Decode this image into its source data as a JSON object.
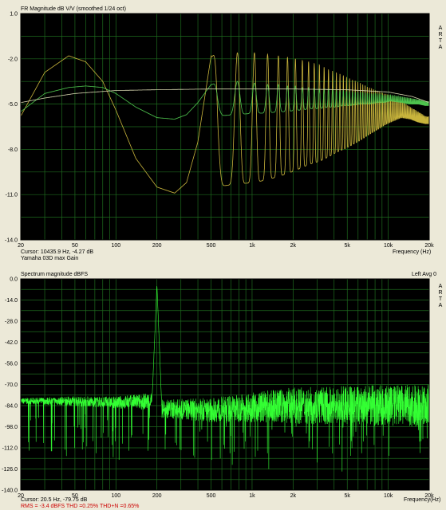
{
  "top": {
    "title": "FR Magnitude dB V/V (smoothed 1/24 oct)",
    "arta": [
      "A",
      "R",
      "T",
      "A"
    ],
    "cursor": "Cursor: 10435.9 Hz, -4.27 dB",
    "device": "Yamaha 03D max Gain",
    "xunit": "Frequency (Hz)"
  },
  "bottom": {
    "title": "Spectrum magnitude dBFS",
    "right": "Left  Avg 0",
    "arta": [
      "A",
      "R",
      "T",
      "A"
    ],
    "cursor": "Cursor:  20.5 Hz, -79.75 dB",
    "stats": "RMS =  -3.4 dBFS   THD =0.25%   THD+N =0.65%",
    "xunit": "Frequency(Hz)"
  },
  "chart_data": [
    {
      "type": "line",
      "title": "FR Magnitude dB V/V (smoothed 1/24 oct)",
      "xlabel": "Frequency (Hz)",
      "ylabel": "",
      "x_scale": "log",
      "xlim": [
        20,
        20000
      ],
      "ylim": [
        -14.0,
        1.0
      ],
      "yticks": [
        "1.0",
        "-2.0",
        "-5.0",
        "-8.0",
        "-11.0",
        "-14.0"
      ],
      "xticks": [
        "20",
        "50",
        "100",
        "200",
        "500",
        "1k",
        "2k",
        "5k",
        "10k",
        "20k"
      ],
      "grid": true,
      "background": "#000000",
      "grid_color": "#1e6a1e",
      "series": [
        {
          "color": "#c8b43c",
          "model": "comb_envelope",
          "low_x": [
            20,
            30,
            45,
            60,
            80,
            100,
            140,
            200,
            270,
            330,
            400,
            500
          ],
          "low_y": [
            -5.8,
            -2.9,
            -1.8,
            -2.2,
            -3.5,
            -5.4,
            -8.6,
            -10.5,
            -10.9,
            -10.2,
            -7.5,
            -1.8
          ],
          "peaks_x": [
            520,
            780,
            1040,
            1300,
            1560,
            1820,
            2080,
            2340,
            2600,
            3120,
            3640,
            4160,
            4680,
            5200,
            6240,
            7280,
            8320,
            9360,
            10400,
            12480,
            14560,
            16640,
            18720
          ],
          "peak_top": [
            -1.7,
            -1.6,
            -1.6,
            -1.7,
            -1.8,
            -1.9,
            -2.0,
            -2.1,
            -2.2,
            -2.4,
            -2.7,
            -2.9,
            -3.1,
            -3.3,
            -3.6,
            -3.9,
            -4.1,
            -4.3,
            -4.4,
            -4.8,
            -5.2,
            -5.5,
            -5.8
          ],
          "peak_bottom": [
            -10.5,
            -10.3,
            -10.2,
            -10.0,
            -9.8,
            -9.6,
            -9.4,
            -9.2,
            -9.0,
            -8.8,
            -8.5,
            -8.2,
            -8.0,
            -7.8,
            -7.4,
            -7.0,
            -6.7,
            -6.4,
            -6.2,
            -5.9,
            -6.0,
            -6.2,
            -6.3
          ]
        },
        {
          "color": "#4ec34e",
          "model": "comb_envelope",
          "low_x": [
            20,
            30,
            45,
            60,
            80,
            100,
            140,
            200,
            270,
            330,
            400,
            500
          ],
          "low_y": [
            -5.5,
            -4.3,
            -3.9,
            -3.8,
            -3.9,
            -4.3,
            -5.2,
            -5.9,
            -6.0,
            -5.7,
            -4.9,
            -3.7
          ],
          "peaks_x": [
            520,
            780,
            1040,
            1300,
            1560,
            1820,
            2080,
            2340,
            2600,
            3120,
            3640,
            4160,
            4680,
            5200,
            6240,
            7280,
            8320,
            9360,
            10400,
            12480,
            14560,
            16640,
            18720
          ],
          "peak_top": [
            -3.6,
            -3.5,
            -3.6,
            -3.7,
            -3.7,
            -3.8,
            -3.8,
            -3.9,
            -3.9,
            -4.0,
            -4.0,
            -4.1,
            -4.1,
            -4.2,
            -4.2,
            -4.3,
            -4.3,
            -4.4,
            -4.4,
            -4.5,
            -4.6,
            -4.7,
            -4.8
          ],
          "peak_bottom": [
            -5.8,
            -5.7,
            -5.6,
            -5.6,
            -5.5,
            -5.5,
            -5.4,
            -5.4,
            -5.3,
            -5.3,
            -5.2,
            -5.2,
            -5.1,
            -5.1,
            -5.0,
            -5.0,
            -4.9,
            -4.9,
            -4.8,
            -4.9,
            -5.0,
            -5.0,
            -5.1
          ]
        },
        {
          "color": "#d8d8b0",
          "model": "line",
          "x": [
            20,
            30,
            50,
            100,
            200,
            500,
            1000,
            2000,
            5000,
            10000,
            15000,
            20000
          ],
          "y": [
            -4.9,
            -4.6,
            -4.3,
            -4.1,
            -4.05,
            -4.0,
            -4.0,
            -4.0,
            -4.05,
            -4.2,
            -4.5,
            -4.9
          ]
        }
      ]
    },
    {
      "type": "line",
      "title": "Spectrum magnitude dBFS",
      "xlabel": "Frequency(Hz)",
      "ylabel": "",
      "x_scale": "log",
      "xlim": [
        20,
        20000
      ],
      "ylim": [
        -140.0,
        0.0
      ],
      "yticks": [
        "0.0",
        "-14.0",
        "-28.0",
        "-42.0",
        "-56.0",
        "-70.0",
        "-84.0",
        "-98.0",
        "-112.0",
        "-126.0",
        "-140.0"
      ],
      "xticks": [
        "20",
        "50",
        "100",
        "200",
        "500",
        "1k",
        "2k",
        "5k",
        "10k",
        "20k"
      ],
      "grid": true,
      "background": "#000000",
      "grid_color": "#1e6a1e",
      "series": [
        {
          "color": "#33ff33",
          "model": "spectrum",
          "tone_x": 200,
          "tone_y": -4,
          "floor_x": [
            20,
            50,
            100,
            190,
            215,
            500,
            1000,
            2000,
            5000,
            10000,
            20000
          ],
          "floor_y": [
            -81,
            -81,
            -82,
            -81,
            -86,
            -87,
            -85,
            -84,
            -84,
            -84,
            -84
          ],
          "spread_x": [
            20,
            100,
            200,
            500,
            1000,
            2000,
            5000,
            10000,
            20000
          ],
          "spread_y": [
            2,
            4,
            6,
            8,
            10,
            12,
            13,
            14,
            14
          ]
        }
      ]
    }
  ]
}
